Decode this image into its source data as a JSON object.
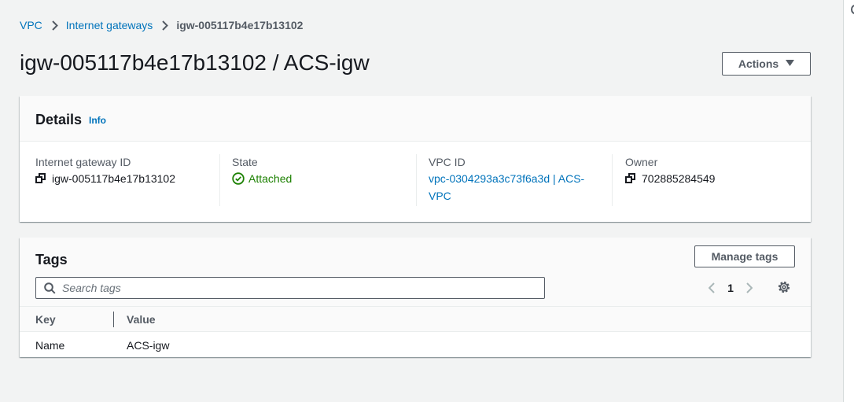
{
  "breadcrumb": {
    "items": [
      "VPC",
      "Internet gateways"
    ],
    "current": "igw-005117b4e17b13102"
  },
  "header": {
    "title": "igw-005117b4e17b13102 / ACS-igw",
    "actions_label": "Actions"
  },
  "details": {
    "title": "Details",
    "info_label": "Info",
    "fields": {
      "gateway_id_label": "Internet gateway ID",
      "gateway_id_value": "igw-005117b4e17b13102",
      "state_label": "State",
      "state_value": "Attached",
      "vpc_label": "VPC ID",
      "vpc_value": "vpc-0304293a3c73f6a3d | ACS-VPC",
      "owner_label": "Owner",
      "owner_value": "702885284549"
    },
    "colors": {
      "link": "#0073bb",
      "success": "#1d8102"
    }
  },
  "tags": {
    "title": "Tags",
    "manage_label": "Manage tags",
    "search_placeholder": "Search tags",
    "page": "1",
    "columns": [
      "Key",
      "Value"
    ],
    "rows": [
      {
        "key": "Name",
        "value": "ACS-igw"
      }
    ]
  }
}
